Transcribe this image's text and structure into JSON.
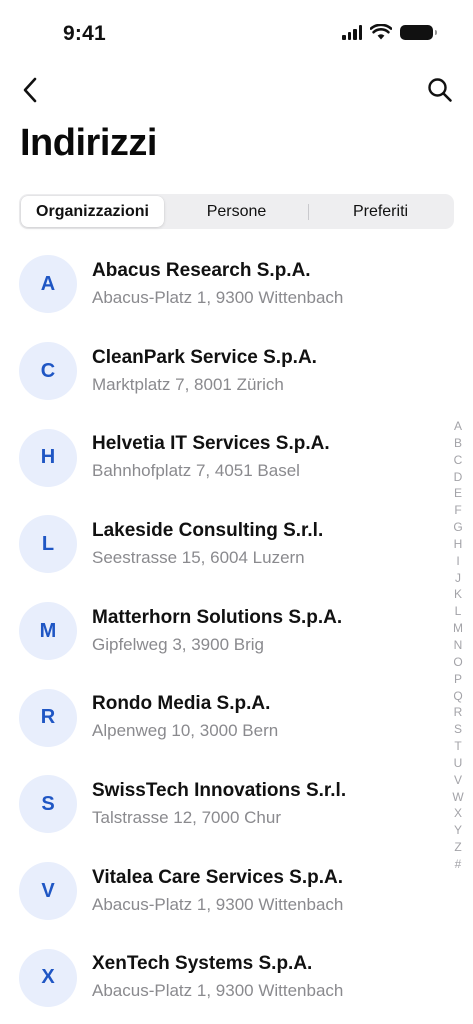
{
  "status_bar": {
    "time": "9:41"
  },
  "header": {
    "title": "Indirizzi"
  },
  "tabs": [
    {
      "label": "Organizzazioni",
      "selected": true
    },
    {
      "label": "Persone",
      "selected": false
    },
    {
      "label": "Preferiti",
      "selected": false
    }
  ],
  "contacts": [
    {
      "initial": "A",
      "name": "Abacus Research S.p.A.",
      "address": "Abacus-Platz 1, 9300 Wittenbach"
    },
    {
      "initial": "C",
      "name": "CleanPark Service S.p.A.",
      "address": "Marktplatz 7, 8001 Zürich"
    },
    {
      "initial": "H",
      "name": "Helvetia IT Services S.p.A.",
      "address": "Bahnhofplatz 7, 4051 Basel"
    },
    {
      "initial": "L",
      "name": "Lakeside Consulting S.r.l.",
      "address": "Seestrasse 15, 6004 Luzern"
    },
    {
      "initial": "M",
      "name": "Matterhorn Solutions S.p.A.",
      "address": "Gipfelweg 3, 3900 Brig"
    },
    {
      "initial": "R",
      "name": "Rondo Media S.p.A.",
      "address": "Alpenweg 10, 3000 Bern"
    },
    {
      "initial": "S",
      "name": "SwissTech Innovations S.r.l.",
      "address": "Talstrasse 12, 7000 Chur"
    },
    {
      "initial": "V",
      "name": "Vitalea Care Services S.p.A.",
      "address": "Abacus-Platz 1, 9300 Wittenbach"
    },
    {
      "initial": "X",
      "name": "XenTech Systems S.p.A.",
      "address": "Abacus-Platz 1, 9300 Wittenbach"
    }
  ],
  "index_letters": [
    "A",
    "B",
    "C",
    "D",
    "E",
    "F",
    "G",
    "H",
    "I",
    "J",
    "K",
    "L",
    "M",
    "N",
    "O",
    "P",
    "Q",
    "R",
    "S",
    "T",
    "U",
    "V",
    "W",
    "X",
    "Y",
    "Z",
    "#"
  ],
  "colors": {
    "accent": "#1f56c4",
    "avatar_bg": "#e8eefc",
    "secondary_text": "#8a8a8e",
    "segment_bg": "#eeeef0"
  },
  "icons": {
    "back": "chevron-left-icon",
    "search": "search-icon",
    "signal": "cellular-signal-icon",
    "wifi": "wifi-icon",
    "battery": "battery-icon"
  }
}
